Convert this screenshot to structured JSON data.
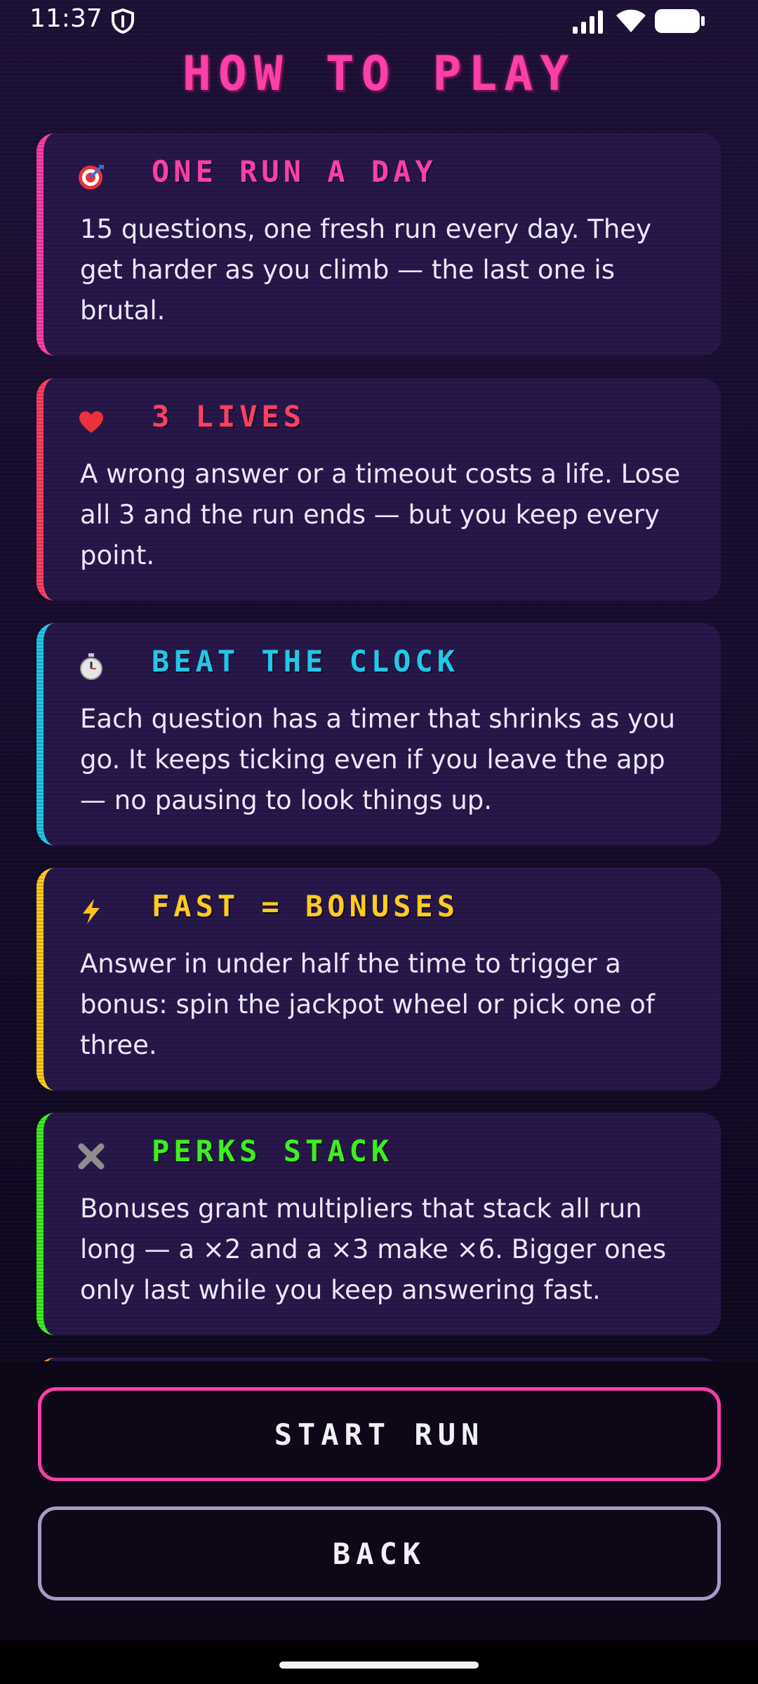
{
  "status_bar": {
    "time": "11:37"
  },
  "page": {
    "title": "HOW TO PLAY"
  },
  "rules": [
    {
      "icon": "target-icon",
      "title": "ONE RUN A DAY",
      "body": "15 questions, one fresh run every day. They get harder as you climb — the last one is brutal.",
      "color": "#ff3fa9"
    },
    {
      "icon": "heart-icon",
      "title": "3 LIVES",
      "body": "A wrong answer or a timeout costs a life. Lose all 3 and the run ends — but you keep every point.",
      "color": "#ff3f63"
    },
    {
      "icon": "stopwatch-icon",
      "title": "BEAT THE CLOCK",
      "body": "Each question has a timer that shrinks as you go. It keeps ticking even if you leave the app — no pausing to look things up.",
      "color": "#21c9e6"
    },
    {
      "icon": "lightning-icon",
      "title": "FAST = BONUSES",
      "body": "Answer in under half the time to trigger a bonus: spin the jackpot wheel or pick one of three.",
      "color": "#ffcc1f"
    },
    {
      "icon": "multiply-icon",
      "title": "PERKS STACK",
      "body": "Bonuses grant multipliers that stack all run long — a ×2 and a ×3 make ×6. Bigger ones only last while you keep answering fast.",
      "color": "#3cf01e"
    }
  ],
  "buttons": {
    "start": "START RUN",
    "back": "BACK"
  }
}
